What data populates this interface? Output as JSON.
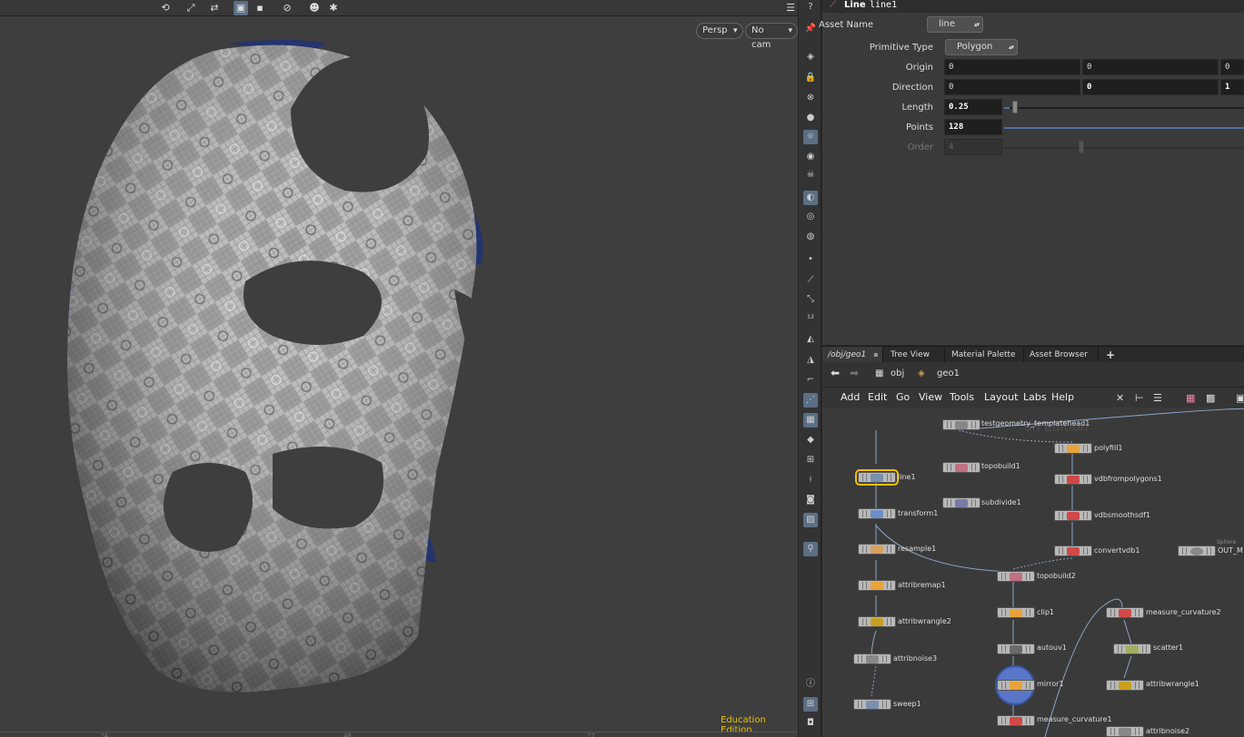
{
  "viewport": {
    "camera_view": "Persp",
    "camera": "No cam",
    "watermark": "Education Edition",
    "ruler_numbers": [
      "24",
      "48",
      "72"
    ]
  },
  "viewport_toolbar": {
    "icons": [
      "rotate-tool-icon",
      "pose-tool-icon",
      "handle-tool-icon",
      "camera-icon",
      "display-icon",
      "record-icon",
      "ghost-icon",
      "snapshot-icon",
      "help-icon",
      "layout-icon",
      "close-icon"
    ]
  },
  "shelf": {
    "icons": [
      "pin-icon",
      "camera-view-icon",
      "lock-icon",
      "no-entry-icon",
      "sphere-icon",
      "light-icon",
      "light-bulb-icon",
      "skull-icon",
      "shaded-icon",
      "eye-icon",
      "render-icon",
      "point-icon",
      "brush-icon",
      "pick-icon",
      "number-icon",
      "paint-bucket-icon",
      "grid-icon",
      "corner-icon",
      "select-icon",
      "checker-icon",
      "diamond-icon",
      "car-icon",
      "axes-icon",
      "scope-icon",
      "image-icon",
      "info-icon",
      "snap-icon",
      "screenshot-icon"
    ]
  },
  "params": {
    "node_type": "Line",
    "node_name": "line1",
    "asset_name_label": "Asset Name",
    "asset_name_value": "line",
    "primitive_type_label": "Primitive Type",
    "primitive_type_value": "Polygon",
    "origin_label": "Origin",
    "origin": [
      "0",
      "0",
      "0"
    ],
    "direction_label": "Direction",
    "direction": [
      "0",
      "0",
      "1"
    ],
    "length_label": "Length",
    "length_value": "0.25",
    "length_fraction": 0.02,
    "points_label": "Points",
    "points_value": "128",
    "order_label": "Order",
    "order_value": "4"
  },
  "network_tabs": [
    {
      "label": "/obj/geo1",
      "active": true
    },
    {
      "label": "Tree View",
      "active": false
    },
    {
      "label": "Material Palette",
      "active": false
    },
    {
      "label": "Asset Browser",
      "active": false
    }
  ],
  "path": {
    "root": "obj",
    "current": "geo1"
  },
  "network_menu": [
    "Add",
    "Edit",
    "Go",
    "View",
    "Tools",
    "Layout",
    "Labs",
    "Help"
  ],
  "network_watermark": "on Edition",
  "nodes": [
    {
      "label": "testgeometry_templatehead1",
      "color": "#888"
    },
    {
      "label": "polyfill1",
      "color": "#e8a23a"
    },
    {
      "label": "line1",
      "color": "#7a8faf"
    },
    {
      "label": "topobuild1",
      "color": "#c07080"
    },
    {
      "label": "vdbfrompolygons1",
      "color": "#d04848"
    },
    {
      "label": "subdivide1",
      "color": "#7a7aa8"
    },
    {
      "label": "transform1",
      "color": "#6b8fc8"
    },
    {
      "label": "vdbsmoothsdf1",
      "color": "#d04848"
    },
    {
      "label": "resample1",
      "color": "#d8a060"
    },
    {
      "label": "convertvdb1",
      "color": "#d04848"
    },
    {
      "label": "OUT_M",
      "color": "#888"
    },
    {
      "label": "topobuild2",
      "color": "#c07080"
    },
    {
      "label": "attribremap1",
      "color": "#e8a23a"
    },
    {
      "label": "clip1",
      "color": "#e8a23a"
    },
    {
      "label": "measure_curvature2",
      "color": "#d04848"
    },
    {
      "label": "attribwrangle2",
      "color": "#c8a020"
    },
    {
      "label": "autouv1",
      "color": "#6b6b6b"
    },
    {
      "label": "scatter1",
      "color": "#a0b060"
    },
    {
      "label": "attribnoise3",
      "color": "#888"
    },
    {
      "label": "mirror1",
      "color": "#e8a23a"
    },
    {
      "label": "attribwrangle1",
      "color": "#c8a020"
    },
    {
      "label": "sweep1",
      "color": "#7a8faf"
    },
    {
      "label": "measure_curvature1",
      "color": "#d04848"
    },
    {
      "label": "attribnoise2",
      "color": "#888"
    }
  ],
  "sphere_label": "Sphere"
}
